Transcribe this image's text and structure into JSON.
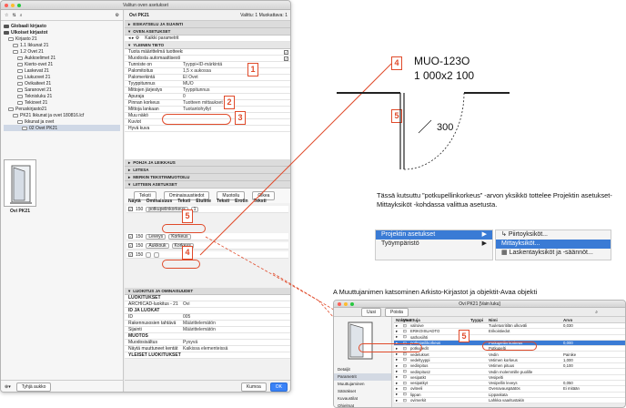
{
  "window1": {
    "title": "Valitun oven asetukset",
    "left": {
      "tree": [
        {
          "label": "Globaali kirjasto",
          "bold": true,
          "depth": 0
        },
        {
          "label": "Ulkoiset kirjastot",
          "bold": true,
          "depth": 0
        },
        {
          "label": "Kirjasto 21",
          "depth": 1
        },
        {
          "label": "1.1 Ikkunat 21",
          "depth": 2
        },
        {
          "label": "1.2 Ovet 21",
          "depth": 2
        },
        {
          "label": "Aukkoelimet 21",
          "depth": 3
        },
        {
          "label": "Kierto-ovet 21",
          "depth": 3
        },
        {
          "label": "Laskevat 21",
          "depth": 3
        },
        {
          "label": "Liukuovet 21",
          "depth": 3
        },
        {
          "label": "Ovikaiteet 21",
          "depth": 3
        },
        {
          "label": "Saranovet 21",
          "depth": 3
        },
        {
          "label": "Teknisluku 21",
          "depth": 3
        },
        {
          "label": "Tekiovet 21",
          "depth": 3
        },
        {
          "label": "Peruskirjasto21",
          "depth": 1
        },
        {
          "label": "PK21 Ikkunat ja ovet 180816.lcf",
          "depth": 2
        },
        {
          "label": "Ikkunat ja ovet",
          "depth": 3
        },
        {
          "label": "02 Ovet PK21",
          "depth": 4,
          "selected": true
        }
      ],
      "preview_label": "Ovi PK21",
      "bottom_button": "Tyhjä aukko"
    },
    "right": {
      "object_name": "Ovi PK21",
      "selected_info": "Valittu: 1 Muokattava: 1",
      "sections": {
        "s1": "ESIKATSELU JA SIJAINTI",
        "s2": "OVEN ASETUKSET",
        "s3": "YLEINEN TIETO",
        "s4": "POHJA JA LEIKKAUS",
        "s5": "LIITESA",
        "s6": "MERKIN TEKSTINMUOTOILU",
        "s7": "LIITTEEN ASETUKSET",
        "s8": "LUOKITUS JA OMINAISUUDET"
      },
      "all_params": "Kaikki parametrit",
      "params": [
        {
          "k": "Tuota määrittelmä tuotteeksi",
          "v": "",
          "check": true
        },
        {
          "k": "Muodosta automaattisesti",
          "v": "",
          "check": true
        },
        {
          "k": "Tunniste on",
          "v": "Tyyppi+ID-märkintä"
        },
        {
          "k": "Palomitoitus",
          "v": "1,5 x aukossa"
        },
        {
          "k": "Palomerkintä",
          "v": "EI Ovet"
        },
        {
          "k": "Tyyppitunnus",
          "v": "MUO"
        },
        {
          "k": "Mittojen järjestys",
          "v": "Tyyppitunnus"
        },
        {
          "k": "Apuraja",
          "v": "0"
        },
        {
          "k": "Pinnan korkeus",
          "v": "Tuotteen mittaukset"
        },
        {
          "k": "Mittoja lankaan",
          "v": "Tuotantohyllyt"
        },
        {
          "k": "Muu näkö",
          "v": ""
        },
        {
          "k": "Kuviot",
          "v": ""
        },
        {
          "k": "Hyvä kuva",
          "v": ""
        }
      ],
      "sub_tabs": [
        "Teksti",
        "Ominaisuustiedot",
        "Muotoilu",
        "Oikea"
      ],
      "table_cols": [
        "Näytä",
        "Ominaisuus",
        "Teksti",
        "Etuliite",
        "Teksti",
        "Erotin",
        "Teksti"
      ],
      "table_rows": [
        {
          "num": "150",
          "field": "potkupelinkorkeus",
          "val": "1"
        },
        {
          "num": "150",
          "field": "Leveys",
          "val": "Korkeus"
        },
        {
          "num": "150",
          "field": "Aukkouk",
          "val": "Korkeus"
        },
        {
          "num": "150",
          "field": "",
          "val": ""
        }
      ],
      "classif": [
        {
          "k": "LUOKITUKSET",
          "v": ""
        },
        {
          "k": "ARCHICAD-luokitus - 21",
          "v": "Ovi"
        },
        {
          "k": "ID JA LUOKAT",
          "v": ""
        },
        {
          "k": "ID",
          "v": "005"
        },
        {
          "k": "Rakennusosien tahtävä",
          "v": "Määrittelemätön"
        },
        {
          "k": "Sijainti",
          "v": "Määrittelemätön"
        },
        {
          "k": "MUOTOS",
          "v": ""
        },
        {
          "k": "Muodosisältus",
          "v": "Pysyvä"
        },
        {
          "k": "Näytä muuttuneet kentät",
          "v": "Kaikissa elementeissä"
        },
        {
          "k": "YLEISET LUOKITUKSET",
          "v": ""
        }
      ],
      "cancel": "Kumoa",
      "ok": "OK"
    }
  },
  "annotations": {
    "n1": "1",
    "n2": "2",
    "n3": "3",
    "n4": "4",
    "n5": "5",
    "door_code": "MUO-123O",
    "door_dims": "1 000x2 100",
    "dim_300": "300",
    "para1": "Tässä kutsuttu ”potkupellinkorkeus” -arvon yksikkö tottelee Projektin asetukset-Mittayksiköt -kohdassa valittua asetusta.",
    "para2": "A Muuttujanimen katsominen Arkisto-Kirjastot ja objektit-Avaa objekti"
  },
  "menu": {
    "items": [
      "Projektin asetukset",
      "Työympäristö"
    ],
    "submenu": [
      "Piirtoyksiköt...",
      "Mittayksiköt...",
      "Laskentayksiköt ja -säännöt..."
    ]
  },
  "window2": {
    "title": "Ovi PK21 [Vain luku]",
    "tabs": [
      "Uusi",
      "Poista"
    ],
    "left_items": [
      "Detaljit",
      "Parametrit",
      "Muuttujaminen",
      "Sätnäkset",
      "Kuvaustilat",
      "Ohjelmat"
    ],
    "cols": [
      "Näkymä",
      "Muuttuja",
      "",
      "Tyyppi",
      "Nimi",
      "Arvo"
    ],
    "rows": [
      {
        "var": "valroive",
        "type": "",
        "name": "Tuuletusritilän ulkoväli",
        "val": "0,030"
      },
      {
        "var": "ERIKOISUADTO",
        "type": "",
        "name": "Erikoistiedot",
        "val": ""
      },
      {
        "var": "sathosiihti",
        "type": "",
        "name": "",
        "val": ""
      },
      {
        "var": "potkupeilikorkeus",
        "type": "",
        "name": "Potkupellin korkeus",
        "val": "0,000",
        "hl": true
      },
      {
        "var": "potkupedit",
        "type": "",
        "name": "Potkupelti",
        "val": ""
      },
      {
        "var": "vedelukset",
        "type": "",
        "name": "Vedin",
        "val": "Painike"
      },
      {
        "var": "vedeltyyppi",
        "type": "",
        "name": "Vetimen korkeus",
        "val": "1,000"
      },
      {
        "var": "vedinpitus",
        "type": "",
        "name": "Vetimen pituus",
        "val": "0,100"
      },
      {
        "var": "vedinpitus2",
        "type": "",
        "name": "Vedin molemmille puolille",
        "val": ""
      },
      {
        "var": "vesipatkt",
        "type": "",
        "name": "Vesipelti",
        "val": ""
      },
      {
        "var": "vesipatkyt",
        "type": "",
        "name": "Vesipellin leveys",
        "val": "0,050"
      },
      {
        "var": "oviteeli",
        "type": "",
        "name": "Ovenavauspäätös",
        "val": "Ei mitään"
      },
      {
        "var": "lippan",
        "type": "",
        "name": "Lippaskata",
        "val": ""
      },
      {
        "var": "ovimerkit",
        "type": "",
        "name": "Lahkka vaaritustakin",
        "val": ""
      }
    ]
  }
}
